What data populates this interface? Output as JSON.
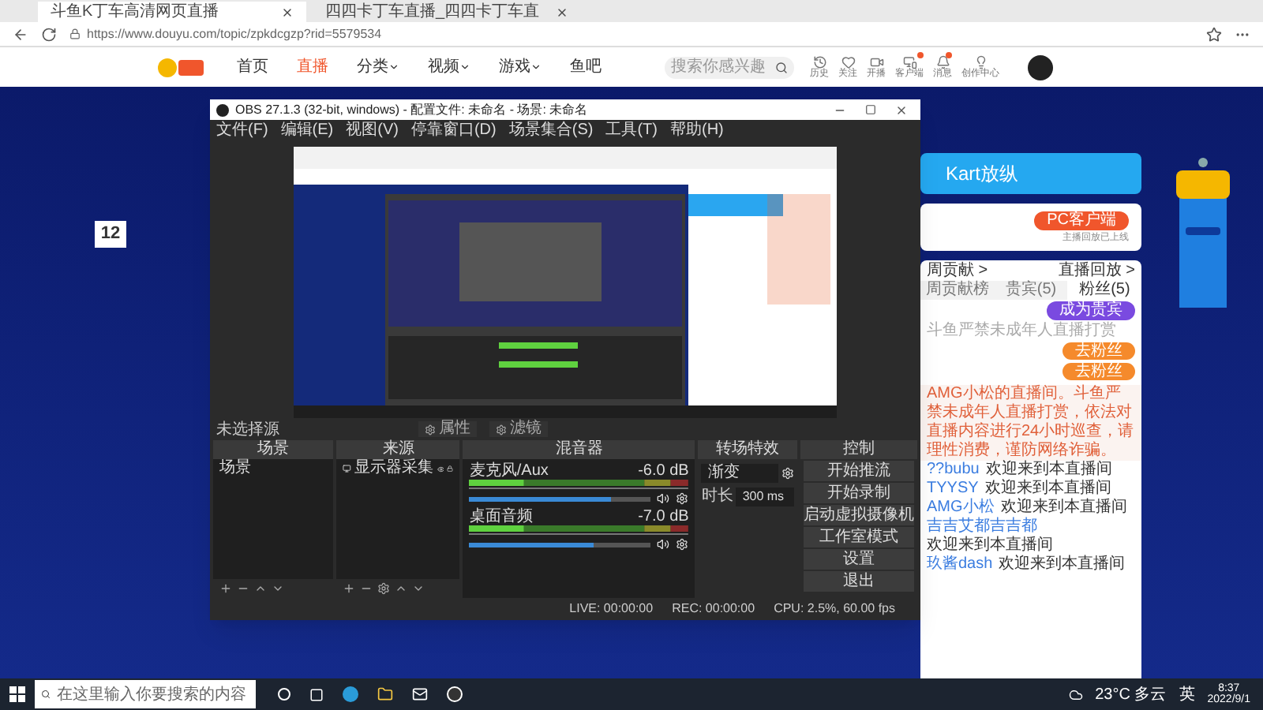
{
  "browser": {
    "tabs": [
      {
        "title": "斗鱼K丁车高清网页直播",
        "selected": true
      },
      {
        "title": "四四卡丁车直播_四四卡丁车直",
        "selected": false
      }
    ],
    "address": "https://www.douyu.com/topic/zpkdcgzp?rid=5579534"
  },
  "site_nav": {
    "links": [
      {
        "label": "首页",
        "selected": false,
        "dropdown": false
      },
      {
        "label": "直播",
        "selected": true,
        "dropdown": false
      },
      {
        "label": "分类",
        "selected": false,
        "dropdown": true
      },
      {
        "label": "视频",
        "selected": false,
        "dropdown": true
      },
      {
        "label": "游戏",
        "selected": false,
        "dropdown": true
      },
      {
        "label": "鱼吧",
        "selected": false,
        "dropdown": false
      }
    ],
    "search": {
      "placeholder": "搜索你感兴趣"
    },
    "icons": [
      {
        "kind": "history",
        "label": "历史",
        "badge": false
      },
      {
        "kind": "follow",
        "label": "关注",
        "badge": false
      },
      {
        "kind": "live",
        "label": "开播",
        "badge": false
      },
      {
        "kind": "client",
        "label": "客户端",
        "badge": true
      },
      {
        "kind": "message",
        "label": "消息",
        "badge": true
      },
      {
        "kind": "creator",
        "label": "创作中心",
        "badge": false
      }
    ]
  },
  "page_left": {
    "count": "12"
  },
  "obs": {
    "title": "OBS 27.1.3 (32-bit, windows) - 配置文件: 未命名 - 场景: 未命名",
    "menu": [
      "文件(F)",
      "编辑(E)",
      "视图(V)",
      "停靠窗口(D)",
      "场景集合(S)",
      "工具(T)",
      "帮助(H)"
    ],
    "source_bar": {
      "label": "未选择源",
      "buttons": [
        "属性",
        "滤镜"
      ]
    },
    "scenes": {
      "title": "场景",
      "items": [
        "场景"
      ]
    },
    "sources": {
      "title": "来源",
      "items": [
        "显示器采集"
      ]
    },
    "mixer": {
      "title": "混音器",
      "channels": [
        {
          "name": "麦克风/Aux",
          "reading": "-6.0 dB",
          "level": 0.78
        },
        {
          "name": "桌面音频",
          "reading": "-7.0 dB",
          "level": 0.68
        }
      ]
    },
    "transitions": {
      "title": "转场特效",
      "type": "渐变",
      "duration_label": "时长",
      "duration": "300 ms"
    },
    "controls": {
      "title": "控制",
      "buttons": [
        "开始推流",
        "开始录制",
        "启动虚拟摄像机",
        "工作室模式",
        "设置",
        "退出"
      ]
    },
    "status": {
      "live": "LIVE: 00:00:00",
      "rec": "REC: 00:00:00",
      "cpu": "CPU: 2.5%, 60.00 fps"
    }
  },
  "page_right": {
    "banner": "Kart放纵",
    "client_button": "PC客户端",
    "client_note": "主播回放已上线",
    "links": [
      "周贡献 >",
      "直播回放 >"
    ],
    "chat_tabs": [
      {
        "label": "周贡献榜",
        "selected": false
      },
      {
        "label": "贵宾(5)",
        "selected": false
      },
      {
        "label": "粉丝(5)",
        "selected": true
      }
    ],
    "vip_button": "成为贵宾",
    "notice": "斗鱼严禁未成年人直播打赏",
    "fan_buttons": [
      "去粉丝",
      "去粉丝"
    ],
    "system_message": "AMG小松的直播间。斗鱼严禁未成年人直播打赏，依法对直播内容进行24小时巡查，请理性消费，谨防网络诈骗。",
    "messages": [
      {
        "user": "??bubu",
        "text": "欢迎来到本直播间"
      },
      {
        "user": "TYYSY",
        "text": "欢迎来到本直播间"
      },
      {
        "user": "AMG小松",
        "text": "欢迎来到本直播间"
      },
      {
        "user": "吉吉艾都吉吉都",
        "text": "欢迎来到本直播间"
      },
      {
        "user": "玖酱dash",
        "text": "欢迎来到本直播间"
      }
    ]
  },
  "taskbar": {
    "search": {
      "placeholder": "在这里输入你要搜索的内容"
    },
    "weather": "23°C 多云",
    "ime": "英",
    "time": "8:37",
    "date": "2022/9/1"
  }
}
